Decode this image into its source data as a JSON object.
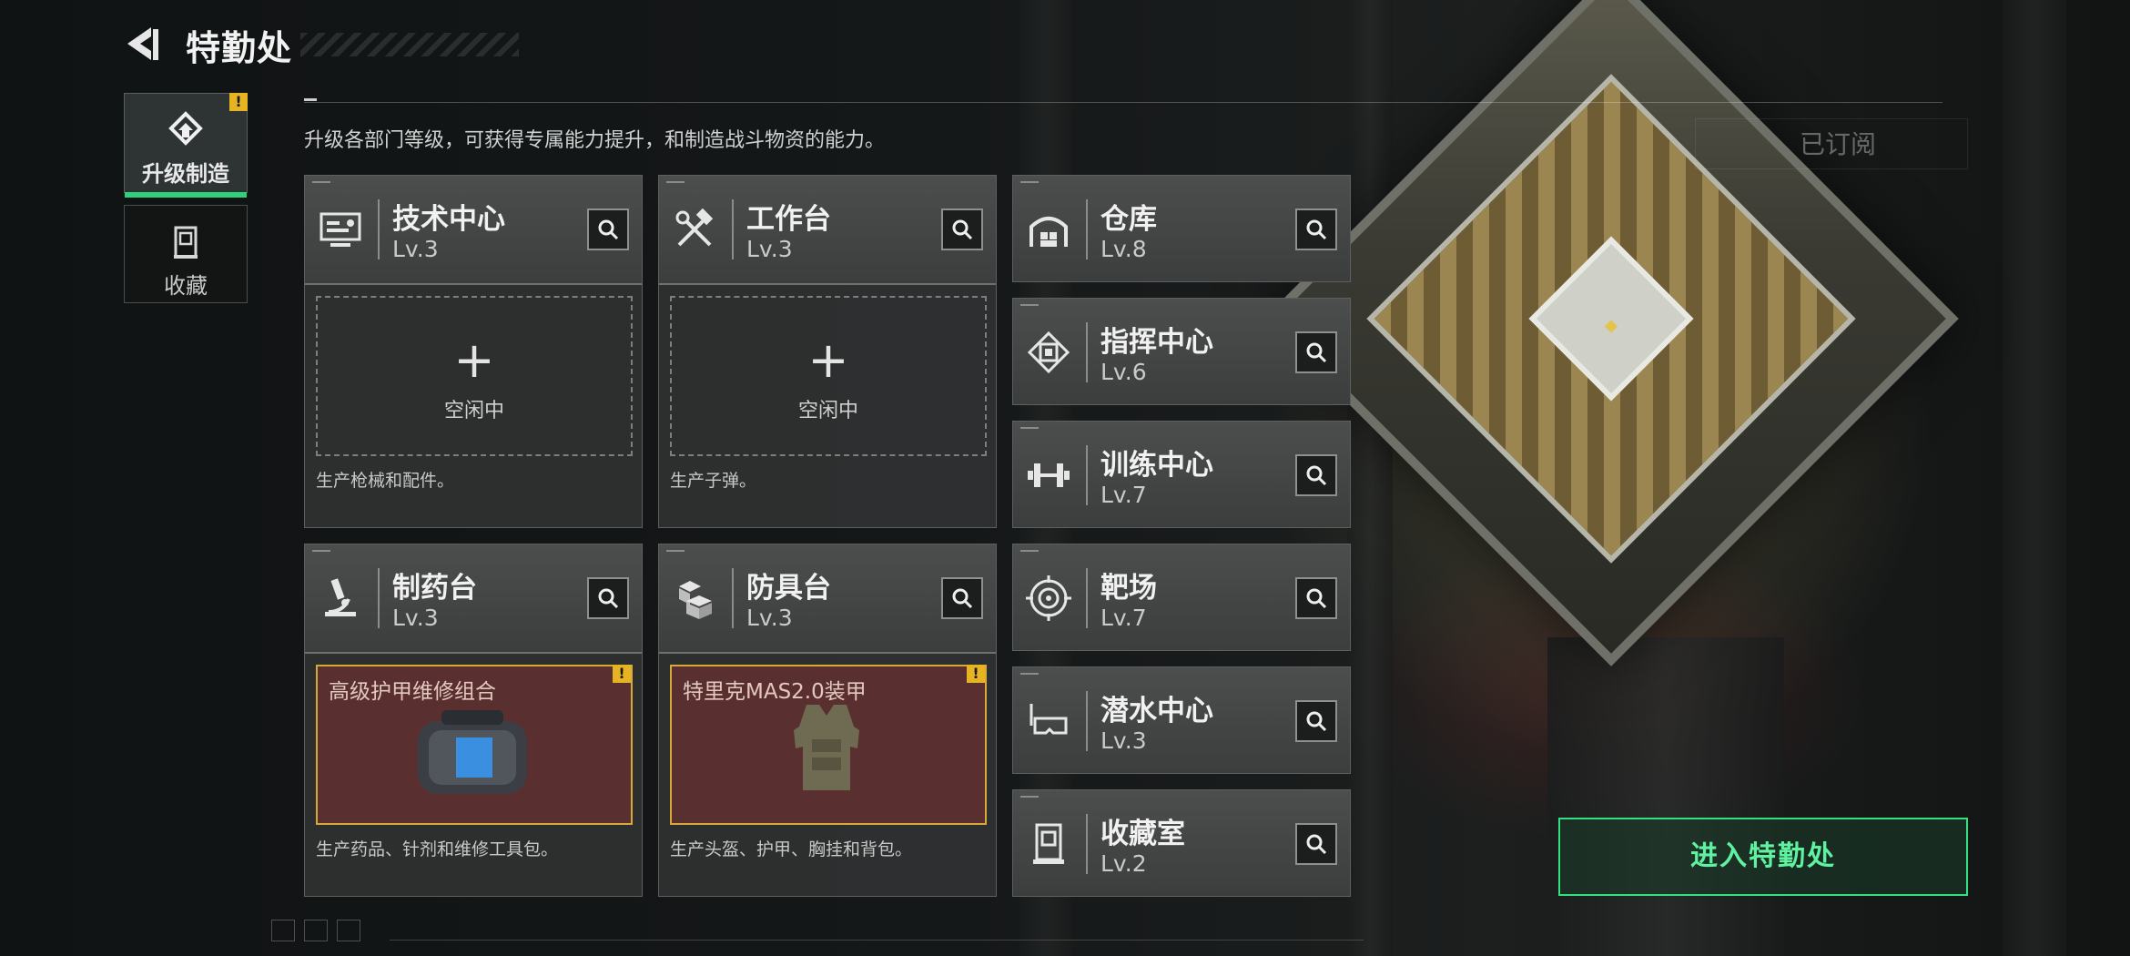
{
  "header": {
    "title": "特勤处"
  },
  "sidebar": {
    "tabs": [
      {
        "label": "升级制造",
        "icon": "upgrade-icon",
        "active": true,
        "alert": "!"
      },
      {
        "label": "收藏",
        "icon": "collection-icon",
        "active": false
      }
    ]
  },
  "description": "升级各部门等级，可获得专属能力提升，和制造战斗物资的能力。",
  "cards": {
    "tech_center": {
      "name": "技术中心",
      "level": "Lv.3",
      "icon": "monitor-icon",
      "slot_status": "空闲中",
      "slot_plus": "+",
      "desc": "生产枪械和配件。"
    },
    "workbench": {
      "name": "工作台",
      "level": "Lv.3",
      "icon": "tools-icon",
      "slot_status": "空闲中",
      "slot_plus": "+",
      "desc": "生产子弹。"
    },
    "pharmacy": {
      "name": "制药台",
      "level": "Lv.3",
      "icon": "microscope-icon",
      "item": "高级护甲维修组合",
      "alert": "!",
      "desc": "生产药品、针剂和维修工具包。"
    },
    "armor_bench": {
      "name": "防具台",
      "level": "Lv.3",
      "icon": "blocks-icon",
      "item": "特里克MAS2.0装甲",
      "alert": "!",
      "desc": "生产头盔、护甲、胸挂和背包。"
    },
    "warehouse": {
      "name": "仓库",
      "level": "Lv.8",
      "icon": "warehouse-icon"
    },
    "command_center": {
      "name": "指挥中心",
      "level": "Lv.6",
      "icon": "chip-icon"
    },
    "training_center": {
      "name": "训练中心",
      "level": "Lv.7",
      "icon": "dumbbell-icon"
    },
    "shooting_range": {
      "name": "靶场",
      "level": "Lv.7",
      "icon": "target-icon"
    },
    "diving_center": {
      "name": "潜水中心",
      "level": "Lv.3",
      "icon": "diving-mask-icon"
    },
    "collection_room": {
      "name": "收藏室",
      "level": "Lv.2",
      "icon": "vault-icon"
    }
  },
  "subscribed_label": "已订阅",
  "enter_button": "进入特勤处",
  "colors": {
    "accent": "#34e07f",
    "alert": "#e6b323",
    "item_bg": "#5a2f2f",
    "item_border": "#d7a93a"
  }
}
